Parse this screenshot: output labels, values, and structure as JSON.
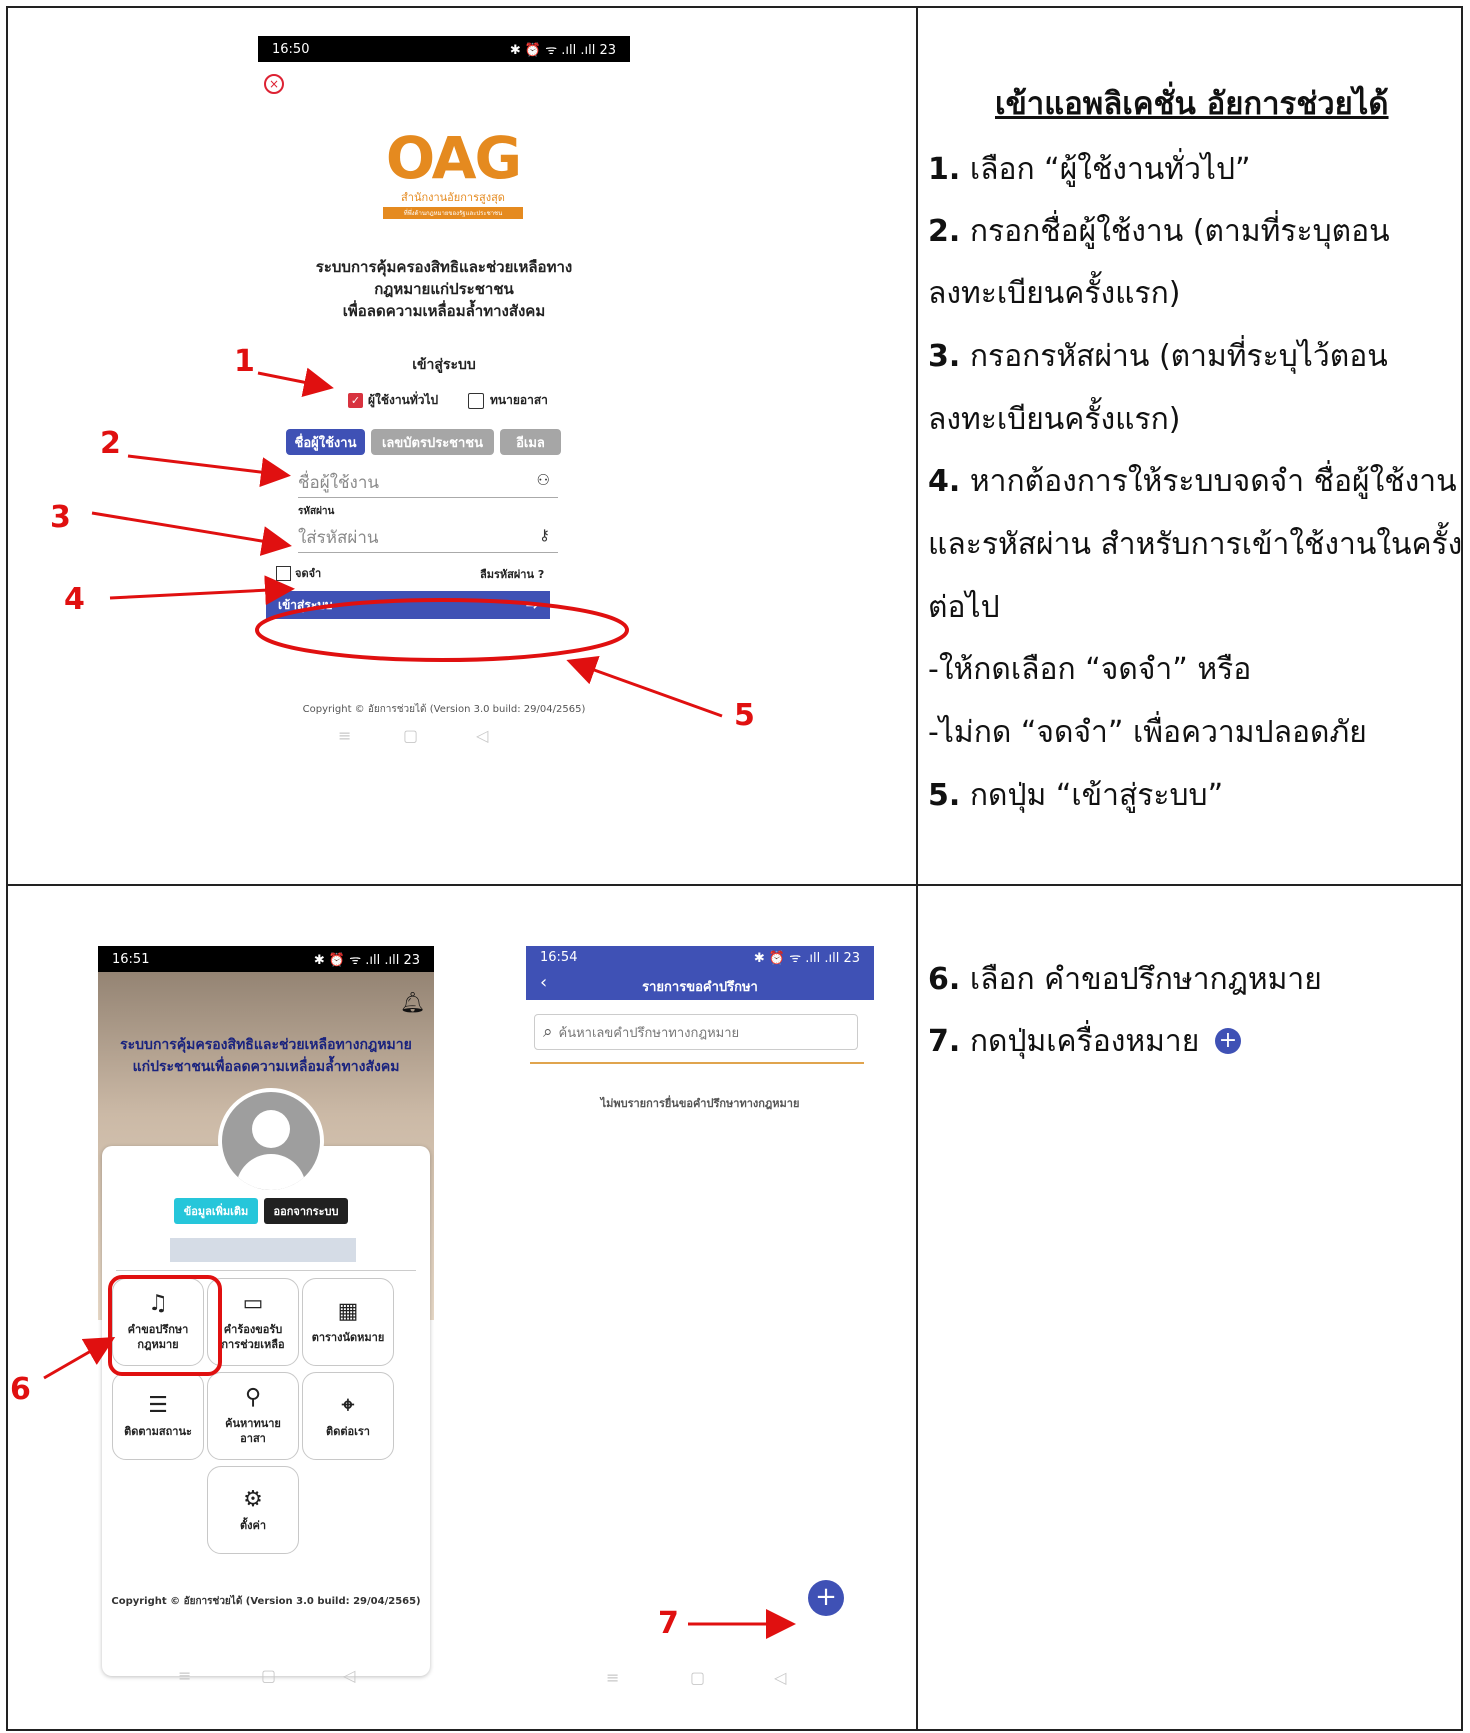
{
  "top_phone": {
    "status_time": "16:50",
    "status_icons": "✱ ⏰ ᯤ .ıll .ıll 23",
    "logo_text": "OAG",
    "logo_subtitle": "สำนักงานอัยการสูงสุด",
    "logo_tagline": "ที่พึ่งด้านกฎหมายของรัฐและประชาชน",
    "system_title_1": "ระบบการคุ้มครองสิทธิและช่วยเหลือทาง",
    "system_title_2": "กฎหมายแก่ประชาชน",
    "system_title_3": "เพื่อลดความเหลื่อมล้ำทางสังคม",
    "login_heading": "เข้าสู่ระบบ",
    "role_general": "ผู้ใช้งานทั่วไป",
    "role_lawyer": "ทนายอาสา",
    "tabs": [
      "ชื่อผู้ใช้งาน",
      "เลขบัตรประชาชน",
      "อีเมล"
    ],
    "username_placeholder": "ชื่อผู้ใช้งาน",
    "password_label": "รหัสผ่าน",
    "password_placeholder": "ใส่รหัสผ่าน",
    "remember_label": "จดจำ",
    "forgot_label": "ลืมรหัสผ่าน ?",
    "login_button": "เข้าสู่ระบบ",
    "copyright": "Copyright © อัยการช่วยได้ (Version 3.0 build: 29/04/2565)"
  },
  "annotations_top": [
    "1",
    "2",
    "3",
    "4",
    "5"
  ],
  "instructions_top": {
    "heading": "เข้าแอพลิเคชั่น อัยการช่วยได้",
    "lines": [
      {
        "num": "1.",
        "text": " เลือก “ผู้ใช้งานทั่วไป”"
      },
      {
        "num": "2.",
        "text": " กรอกชื่อผู้ใช้งาน (ตามที่ระบุตอน"
      },
      {
        "num": "",
        "text": "ลงทะเบียนครั้งแรก)"
      },
      {
        "num": "3.",
        "text": " กรอกรหัสผ่าน (ตามที่ระบุไว้ตอน"
      },
      {
        "num": "",
        "text": "ลงทะเบียนครั้งแรก)"
      },
      {
        "num": "4.",
        "text": " หากต้องการให้ระบบจดจำ ชื่อผู้ใช้งาน"
      },
      {
        "num": "",
        "text": "และรหัสผ่าน สำหรับการเข้าใช้งานในครั้ง"
      },
      {
        "num": "",
        "text": "ต่อไป"
      },
      {
        "num": "",
        "text": "-ให้กดเลือก “จดจำ” หรือ"
      },
      {
        "num": "",
        "text": "-ไม่กด “จดจำ” เพื่อความปลอดภัย"
      },
      {
        "num": "5.",
        "text": " กดปุ่ม “เข้าสู่ระบบ”"
      }
    ]
  },
  "home_phone": {
    "status_time": "16:51",
    "status_icons": "✱ ⏰ ᯤ .ıll .ıll 23",
    "title_1": "ระบบการคุ้มครองสิทธิและช่วยเหลือทางกฎหมาย",
    "title_2": "แก่ประชาชนเพื่อลดความเหลื่อมล้ำทางสังคม",
    "more_info_button": "ข้อมูลเพิ่มเติม",
    "logout_button": "ออกจากระบบ",
    "menu": [
      {
        "icon": "headset-icon",
        "glyph": "♫",
        "label_1": "คำขอปรึกษา",
        "label_2": "กฎหมาย"
      },
      {
        "icon": "document-icon",
        "glyph": "▭",
        "label_1": "คำร้องขอรับ",
        "label_2": "การช่วยเหลือ"
      },
      {
        "icon": "calendar-icon",
        "glyph": "▦",
        "label_1": "ตารางนัดหมาย",
        "label_2": ""
      },
      {
        "icon": "checklist-icon",
        "glyph": "☰",
        "label_1": "ติดตามสถานะ",
        "label_2": ""
      },
      {
        "icon": "search-person-icon",
        "glyph": "⚲",
        "label_1": "ค้นหาทนาย",
        "label_2": "อาสา"
      },
      {
        "icon": "location-icon",
        "glyph": "⌖",
        "label_1": "ติดต่อเรา",
        "label_2": ""
      },
      {
        "icon": "gear-icon",
        "glyph": "⚙",
        "label_1": "ตั้งค่า",
        "label_2": ""
      }
    ],
    "copyright": "Copyright © อัยการช่วยได้ (Version 3.0 build: 29/04/2565)"
  },
  "list_phone": {
    "status_time": "16:54",
    "status_icons": "✱ ⏰ ᯤ .ıll .ıll 23",
    "header_title": "รายการขอคำปรึกษา",
    "search_placeholder": "ค้นหาเลขคำปรึกษาทางกฎหมาย",
    "empty_message": "ไม่พบรายการยื่นขอคำปรึกษาทางกฎหมาย",
    "fab_symbol": "+"
  },
  "annotations_bottom": [
    "6",
    "7"
  ],
  "instructions_bottom": {
    "lines": [
      {
        "num": "6.",
        "text": " เลือก คำขอปรึกษากฎหมาย"
      },
      {
        "num": "7.",
        "text": " กดปุ่มเครื่องหมาย"
      }
    ],
    "plus_symbol": "+"
  },
  "colors": {
    "accent_blue": "#3f51b5",
    "tab_inactive": "#a6a6a6",
    "annotation_red": "#e01010",
    "logo_orange": "#e58a1f",
    "cyan_button": "#26c6da"
  }
}
